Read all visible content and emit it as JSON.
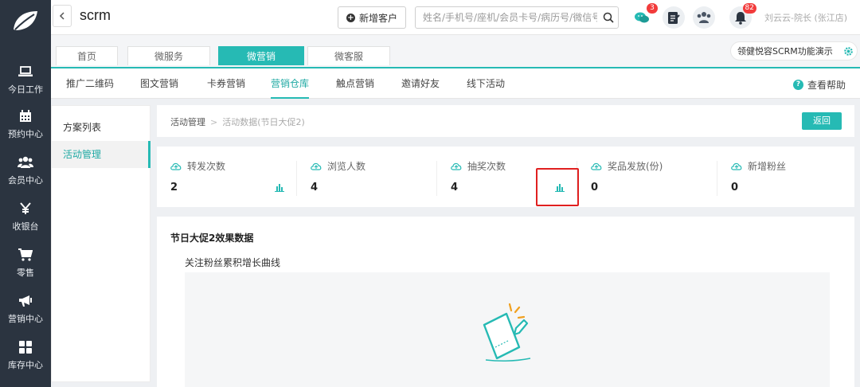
{
  "nav": {
    "items": [
      {
        "label": "今日工作",
        "icon": "laptop-icon"
      },
      {
        "label": "预约中心",
        "icon": "calendar-icon"
      },
      {
        "label": "会员中心",
        "icon": "users-icon"
      },
      {
        "label": "收银台",
        "icon": "yen-icon"
      },
      {
        "label": "零售",
        "icon": "cart-icon"
      },
      {
        "label": "营销中心",
        "icon": "megaphone-icon"
      },
      {
        "label": "库存中心",
        "icon": "grid-icon"
      }
    ]
  },
  "header": {
    "title": "scrm",
    "new_customer_label": "新增客户",
    "search_placeholder": "姓名/手机号/座机/会员卡号/病历号/微信号",
    "wechat_badge": "3",
    "notification_badge": "82",
    "user_label": "刘云云-院长 (张江店)"
  },
  "modules": {
    "tabs": [
      {
        "label": "首页",
        "active": false
      },
      {
        "label": "微服务",
        "active": false
      },
      {
        "label": "微营销",
        "active": true
      },
      {
        "label": "微客服",
        "active": false
      }
    ],
    "guide_label": "领健悦容SCRM功能演示"
  },
  "subnav": {
    "tabs": [
      {
        "label": "推广二维码",
        "active": false
      },
      {
        "label": "图文营销",
        "active": false
      },
      {
        "label": "卡券营销",
        "active": false
      },
      {
        "label": "营销仓库",
        "active": true
      },
      {
        "label": "触点营销",
        "active": false
      },
      {
        "label": "邀请好友",
        "active": false
      },
      {
        "label": "线下活动",
        "active": false
      }
    ],
    "help_label": "查看帮助"
  },
  "side_menu": {
    "items": [
      {
        "label": "方案列表",
        "active": false
      },
      {
        "label": "活动管理",
        "active": true
      }
    ]
  },
  "breadcrumb": {
    "root": "活动管理",
    "separator": ">",
    "current": "活动数据(节日大促2)",
    "return_label": "返回"
  },
  "stats": [
    {
      "label": "转发次数",
      "value": "2",
      "has_chart": true
    },
    {
      "label": "浏览人数",
      "value": "4",
      "has_chart": false
    },
    {
      "label": "抽奖次数",
      "value": "4",
      "has_chart": true
    },
    {
      "label": "奖品发放(份)",
      "value": "0",
      "has_chart": false
    },
    {
      "label": "新增粉丝",
      "value": "0",
      "has_chart": false
    }
  ],
  "effect": {
    "title": "节日大促2效果数据",
    "chart_title": "关注粉丝累积增长曲线"
  },
  "colors": {
    "accent": "#26bab4",
    "nav_bg": "#2b3440",
    "badge": "#f23b3b",
    "highlight": "#e02020"
  }
}
